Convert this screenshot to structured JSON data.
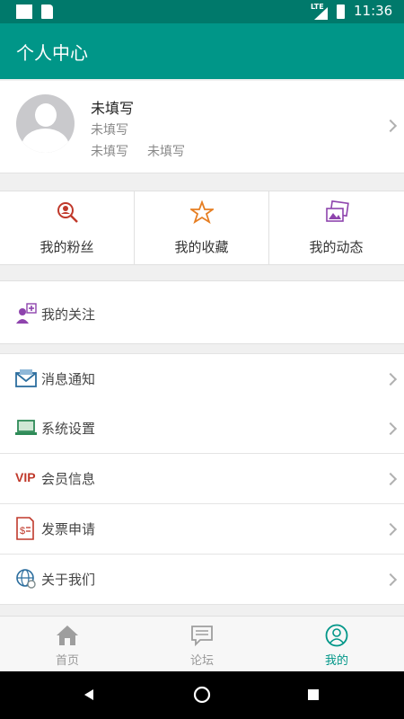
{
  "status_bar": {
    "time": "11:36",
    "network": "LTE"
  },
  "app_bar": {
    "title": "个人中心"
  },
  "profile": {
    "name": "未填写",
    "line1": "未填写",
    "line2a": "未填写",
    "line2b": "未填写"
  },
  "stats": [
    {
      "label": "我的粉丝",
      "icon": "search-person-icon"
    },
    {
      "label": "我的收藏",
      "icon": "star-icon"
    },
    {
      "label": "我的动态",
      "icon": "photos-icon"
    }
  ],
  "follow": {
    "label": "我的关注",
    "icon": "add-person-icon"
  },
  "menu": [
    {
      "label": "消息通知",
      "icon": "mail-icon"
    },
    {
      "label": "系统设置",
      "icon": "laptop-icon"
    },
    {
      "label": "会员信息",
      "icon": "vip-icon",
      "badge": "VIP"
    },
    {
      "label": "发票申请",
      "icon": "invoice-icon"
    },
    {
      "label": "关于我们",
      "icon": "globe-icon"
    }
  ],
  "tabs": [
    {
      "label": "首页",
      "icon": "home-icon"
    },
    {
      "label": "论坛",
      "icon": "chat-icon"
    },
    {
      "label": "我的",
      "icon": "profile-icon",
      "active": true
    }
  ],
  "colors": {
    "primary": "#009688",
    "status_bar": "#00796b",
    "accent_red": "#c0392b"
  }
}
